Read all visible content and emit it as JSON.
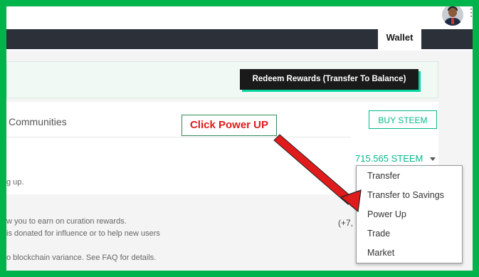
{
  "header": {
    "avatar_alt": "user-avatar"
  },
  "nav": {
    "active_tab": "Wallet"
  },
  "rewards": {
    "redeem_label": "Redeem Rewards (Transfer To Balance)"
  },
  "section": {
    "communities_label": "Communities",
    "buy_label": "BUY STEEM",
    "balance": "715.565 STEEM",
    "powering_text": "g up.",
    "curation_text": "w you to earn on curation rewards.",
    "donation_text": "is donated for influence or to help new users",
    "variance_text": "o blockchain variance. See FAQ for details.",
    "partial_value": "(+7,"
  },
  "dropdown": {
    "items": [
      "Transfer",
      "Transfer to Savings",
      "Power Up",
      "Trade",
      "Market"
    ]
  },
  "annotation": {
    "callout_text": "Click Power UP",
    "arrow_color": "#e01b1b"
  },
  "colors": {
    "frame": "#00b34a",
    "accent": "#06b98a",
    "navbar": "#2c3038"
  }
}
